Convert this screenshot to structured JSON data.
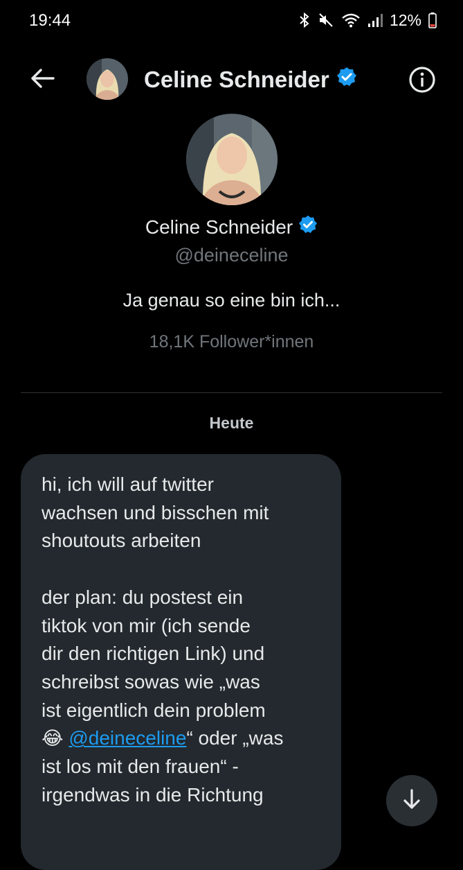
{
  "status_bar": {
    "time": "19:44",
    "battery": "12%",
    "icons": [
      "bluetooth-icon",
      "mute-icon",
      "wifi-icon",
      "signal-icon",
      "battery-icon"
    ]
  },
  "header": {
    "name": "Celine Schneider",
    "verified": true,
    "icons": [
      "back-arrow-icon",
      "info-icon",
      "verified-badge-icon"
    ]
  },
  "profile": {
    "name": "Celine Schneider",
    "handle": "@deineceline",
    "bio": "Ja genau so eine bin ich...",
    "followers": "18,1K Follower*innen"
  },
  "conversation": {
    "date_separator": "Heute",
    "message": {
      "part1": "hi, ich will auf twitter\nwachsen und bisschen mit\nshoutouts arbeiten\n\nder plan: du postest ein\ntiktok von mir (ich sende\ndir den richtigen Link) und\nschreibst sowas wie „was\nist eigentlich dein problem\n",
      "emoji": "😂",
      "mention": "@deineceline",
      "part2": "“ oder „was\nist los mit den frauen“ -\nirgendwas in die Richtung"
    }
  },
  "colors": {
    "background": "#000000",
    "bubble": "#23292e",
    "accent": "#1d9bf0",
    "secondary_text": "#71767b"
  }
}
